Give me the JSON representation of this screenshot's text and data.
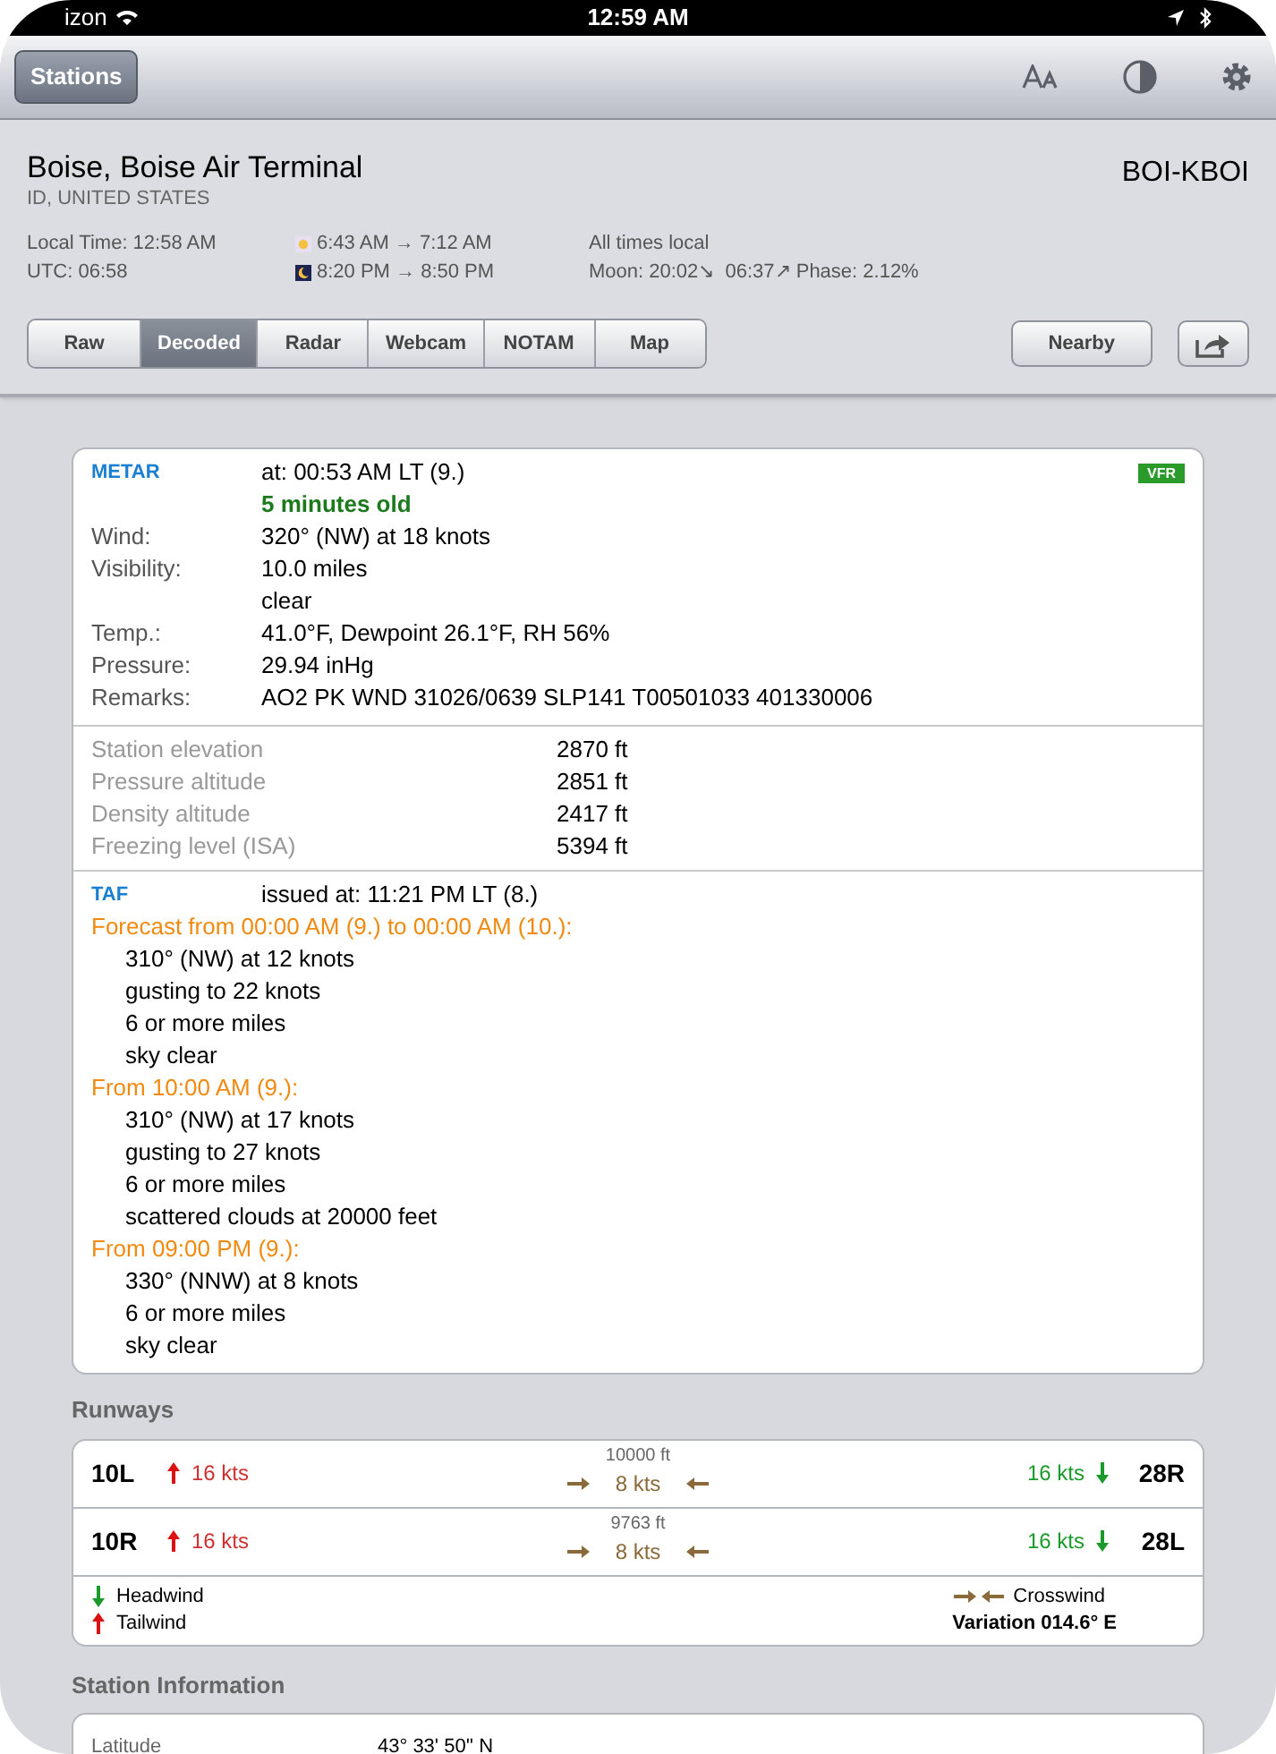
{
  "status_bar": {
    "carrier": "izon",
    "time": "12:59 AM"
  },
  "toolbar": {
    "back_button": "Stations"
  },
  "station": {
    "name": "Boise, Boise Air Terminal",
    "region": "ID, UNITED STATES",
    "code": "BOI-KBOI",
    "local_time": "Local Time: 12:58 AM",
    "utc": "UTC: 06:58",
    "sunrise": "6:43 AM → 7:12 AM",
    "sunset": "8:20 PM → 8:50 PM",
    "times_note": "All times local",
    "moon": "Moon: 20:02↘  06:37↗ Phase: 2.12%"
  },
  "tabs": [
    {
      "label": "Raw",
      "selected": false
    },
    {
      "label": "Decoded",
      "selected": true
    },
    {
      "label": "Radar",
      "selected": false
    },
    {
      "label": "Webcam",
      "selected": false
    },
    {
      "label": "NOTAM",
      "selected": false
    },
    {
      "label": "Map",
      "selected": false
    }
  ],
  "nearby_button": "Nearby",
  "metar": {
    "label": "METAR",
    "time": "at: 00:53 AM LT (9.)",
    "age": "5 minutes old",
    "flight_category": "VFR",
    "rows": [
      {
        "label": "Wind:",
        "value": "320° (NW) at 18 knots"
      },
      {
        "label": "Visibility:",
        "value": "10.0 miles"
      },
      {
        "value": "clear"
      },
      {
        "label": "Temp.:",
        "value": "41.0°F, Dewpoint 26.1°F, RH 56%"
      },
      {
        "label": "Pressure:",
        "value": "29.94 inHg"
      },
      {
        "label": "Remarks:",
        "value": "AO2 PK WND 31026/0639 SLP141 T00501033 401330006"
      }
    ]
  },
  "derived": [
    {
      "label": "Station elevation",
      "value": "2870 ft"
    },
    {
      "label": "Pressure altitude",
      "value": "2851 ft"
    },
    {
      "label": "Density altitude",
      "value": "2417 ft"
    },
    {
      "label": "Freezing level (ISA)",
      "value": "5394 ft"
    }
  ],
  "taf": {
    "label": "TAF",
    "issued": "issued at: 11:21 PM LT (8.)",
    "periods": [
      {
        "title": "Forecast from 00:00 AM (9.) to 00:00 AM (10.):",
        "lines": [
          "310° (NW) at 12 knots",
          "gusting to 22 knots",
          "6 or more miles",
          "sky clear"
        ]
      },
      {
        "title": "From 10:00 AM (9.):",
        "lines": [
          "310° (NW) at 17 knots",
          "gusting to 27 knots",
          "6 or more miles",
          "scattered clouds at 20000 feet"
        ]
      },
      {
        "title": "From 09:00 PM (9.):",
        "lines": [
          "330° (NNW) at 8 knots",
          "6 or more miles",
          "sky clear"
        ]
      }
    ]
  },
  "runways": {
    "title": "Runways",
    "rows": [
      {
        "left": "10L",
        "tailwind": "16 kts",
        "length": "10000 ft",
        "crosswind": "8 kts",
        "headwind": "16 kts",
        "right": "28R"
      },
      {
        "left": "10R",
        "tailwind": "16 kts",
        "length": "9763 ft",
        "crosswind": "8 kts",
        "headwind": "16 kts",
        "right": "28L"
      }
    ],
    "legend": {
      "headwind": "Headwind",
      "tailwind": "Tailwind",
      "crosswind": "Crosswind",
      "variation": "Variation 014.6° E"
    }
  },
  "station_info": {
    "title": "Station Information",
    "rows": [
      {
        "label": "Latitude",
        "value": "43° 33' 50'' N"
      }
    ]
  }
}
